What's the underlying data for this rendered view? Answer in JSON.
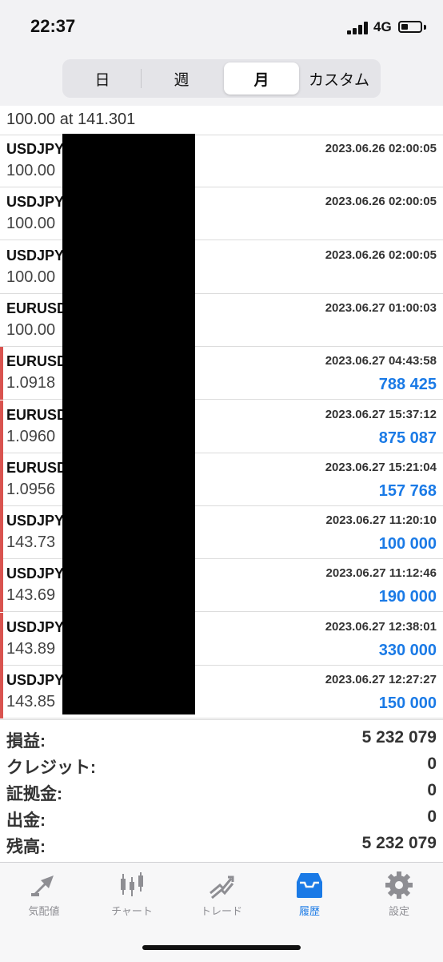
{
  "status_bar": {
    "time": "22:37",
    "network": "4G"
  },
  "period_tabs": [
    {
      "label": "日",
      "active": false
    },
    {
      "label": "週",
      "active": false
    },
    {
      "label": "月",
      "active": true
    },
    {
      "label": "カスタム",
      "active": false
    }
  ],
  "partial_row": {
    "text": "100.00 at 141.301"
  },
  "trades": [
    {
      "symbol": "USDJPY",
      "price": "100.00",
      "datetime": "2023.06.26 02:00:05",
      "profit": "",
      "marker": false
    },
    {
      "symbol": "USDJPY",
      "price": "100.00",
      "datetime": "2023.06.26 02:00:05",
      "profit": "",
      "marker": false
    },
    {
      "symbol": "USDJPY",
      "price": "100.00",
      "datetime": "2023.06.26 02:00:05",
      "profit": "",
      "marker": false
    },
    {
      "symbol": "EURUSD",
      "price": "100.00",
      "datetime": "2023.06.27 01:00:03",
      "profit": "",
      "marker": false
    },
    {
      "symbol": "EURUSD",
      "price": "1.0918",
      "datetime": "2023.06.27 04:43:58",
      "profit": "788 425",
      "marker": true
    },
    {
      "symbol": "EURUSD",
      "price": "1.0960",
      "datetime": "2023.06.27 15:37:12",
      "profit": "875 087",
      "marker": true
    },
    {
      "symbol": "EURUSD",
      "price": "1.0956",
      "datetime": "2023.06.27 15:21:04",
      "profit": "157 768",
      "marker": true
    },
    {
      "symbol": "USDJPY",
      "price": "143.73",
      "datetime": "2023.06.27 11:20:10",
      "profit": "100 000",
      "marker": true
    },
    {
      "symbol": "USDJPY",
      "price": "143.69",
      "datetime": "2023.06.27 11:12:46",
      "profit": "190 000",
      "marker": true
    },
    {
      "symbol": "USDJPY",
      "price": "143.89",
      "datetime": "2023.06.27 12:38:01",
      "profit": "330 000",
      "marker": true
    },
    {
      "symbol": "USDJPY",
      "price": "143.85",
      "datetime": "2023.06.27 12:27:27",
      "profit": "150 000",
      "marker": true
    }
  ],
  "summary": [
    {
      "label": "損益:",
      "value": "5 232 079"
    },
    {
      "label": "クレジット:",
      "value": "0"
    },
    {
      "label": "証拠金:",
      "value": "0"
    },
    {
      "label": "出金:",
      "value": "0"
    },
    {
      "label": "残高:",
      "value": "5 232 079"
    }
  ],
  "tabbar": [
    {
      "label": "気配値",
      "icon": "quotes-icon",
      "active": false
    },
    {
      "label": "チャート",
      "icon": "chart-icon",
      "active": false
    },
    {
      "label": "トレード",
      "icon": "trade-icon",
      "active": false
    },
    {
      "label": "履歴",
      "icon": "history-icon",
      "active": true
    },
    {
      "label": "設定",
      "icon": "settings-icon",
      "active": false
    }
  ],
  "colors": {
    "profit": "#1a7ae6",
    "marker": "#d9534f",
    "active_tab": "#1a7ae6"
  }
}
